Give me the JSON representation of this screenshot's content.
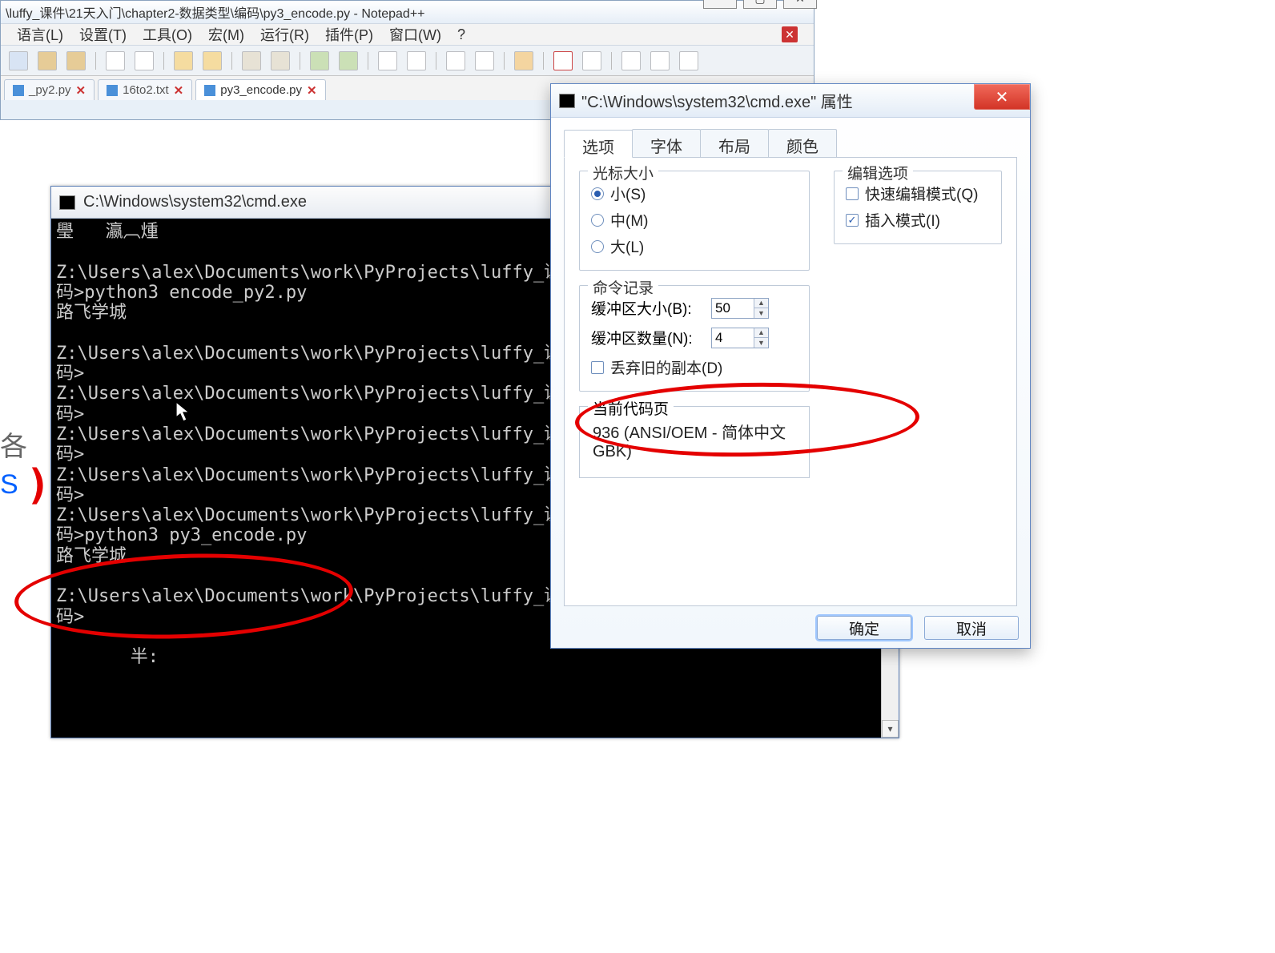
{
  "notepadpp": {
    "title": "\\luffy_课件\\21天入门\\chapter2-数据类型\\编码\\py3_encode.py - Notepad++",
    "menu": [
      "语言(L)",
      "设置(T)",
      "工具(O)",
      "宏(M)",
      "运行(R)",
      "插件(P)",
      "窗口(W)",
      "?"
    ],
    "tabs": [
      {
        "label": "_py2.py",
        "active": false
      },
      {
        "label": "16to2.txt",
        "active": false
      },
      {
        "label": "py3_encode.py",
        "active": true
      }
    ]
  },
  "bg_editor": {
    "line1": "各",
    "line2": "S"
  },
  "cmd": {
    "title": "C:\\Windows\\system32\\cmd.exe",
    "lines": [
      "璺   瀛︹煄",
      "",
      "Z:\\Users\\alex\\Documents\\work\\PyProjects\\luffy_课",
      "码>python3 encode_py2.py",
      "路飞学城",
      "",
      "Z:\\Users\\alex\\Documents\\work\\PyProjects\\luffy_课",
      "码>",
      "Z:\\Users\\alex\\Documents\\work\\PyProjects\\luffy_课",
      "码>",
      "Z:\\Users\\alex\\Documents\\work\\PyProjects\\luffy_课",
      "码>",
      "Z:\\Users\\alex\\Documents\\work\\PyProjects\\luffy_课",
      "码>",
      "Z:\\Users\\alex\\Documents\\work\\PyProjects\\luffy_课",
      "码>python3 py3_encode.py",
      "路飞学城",
      "",
      "Z:\\Users\\alex\\Documents\\work\\PyProjects\\luffy_课",
      "码>",
      "",
      "       半:"
    ]
  },
  "props": {
    "title": "\"C:\\Windows\\system32\\cmd.exe\" 属性",
    "tabs": [
      "选项",
      "字体",
      "布局",
      "颜色"
    ],
    "active_tab": 0,
    "cursor_group": {
      "legend": "光标大小",
      "options": [
        {
          "label": "小(S)",
          "selected": true
        },
        {
          "label": "中(M)",
          "selected": false
        },
        {
          "label": "大(L)",
          "selected": false
        }
      ]
    },
    "history_group": {
      "legend": "命令记录",
      "buffer_size_label": "缓冲区大小(B):",
      "buffer_size_value": "50",
      "buffer_count_label": "缓冲区数量(N):",
      "buffer_count_value": "4",
      "discard_label": "丢弃旧的副本(D)",
      "discard_checked": false
    },
    "edit_group": {
      "legend": "编辑选项",
      "quick_edit_label": "快速编辑模式(Q)",
      "quick_edit_checked": false,
      "insert_mode_label": "插入模式(I)",
      "insert_mode_checked": true
    },
    "codepage_group": {
      "legend": "当前代码页",
      "text": "936    (ANSI/OEM - 简体中文 GBK)"
    },
    "ok_label": "确定",
    "cancel_label": "取消"
  }
}
